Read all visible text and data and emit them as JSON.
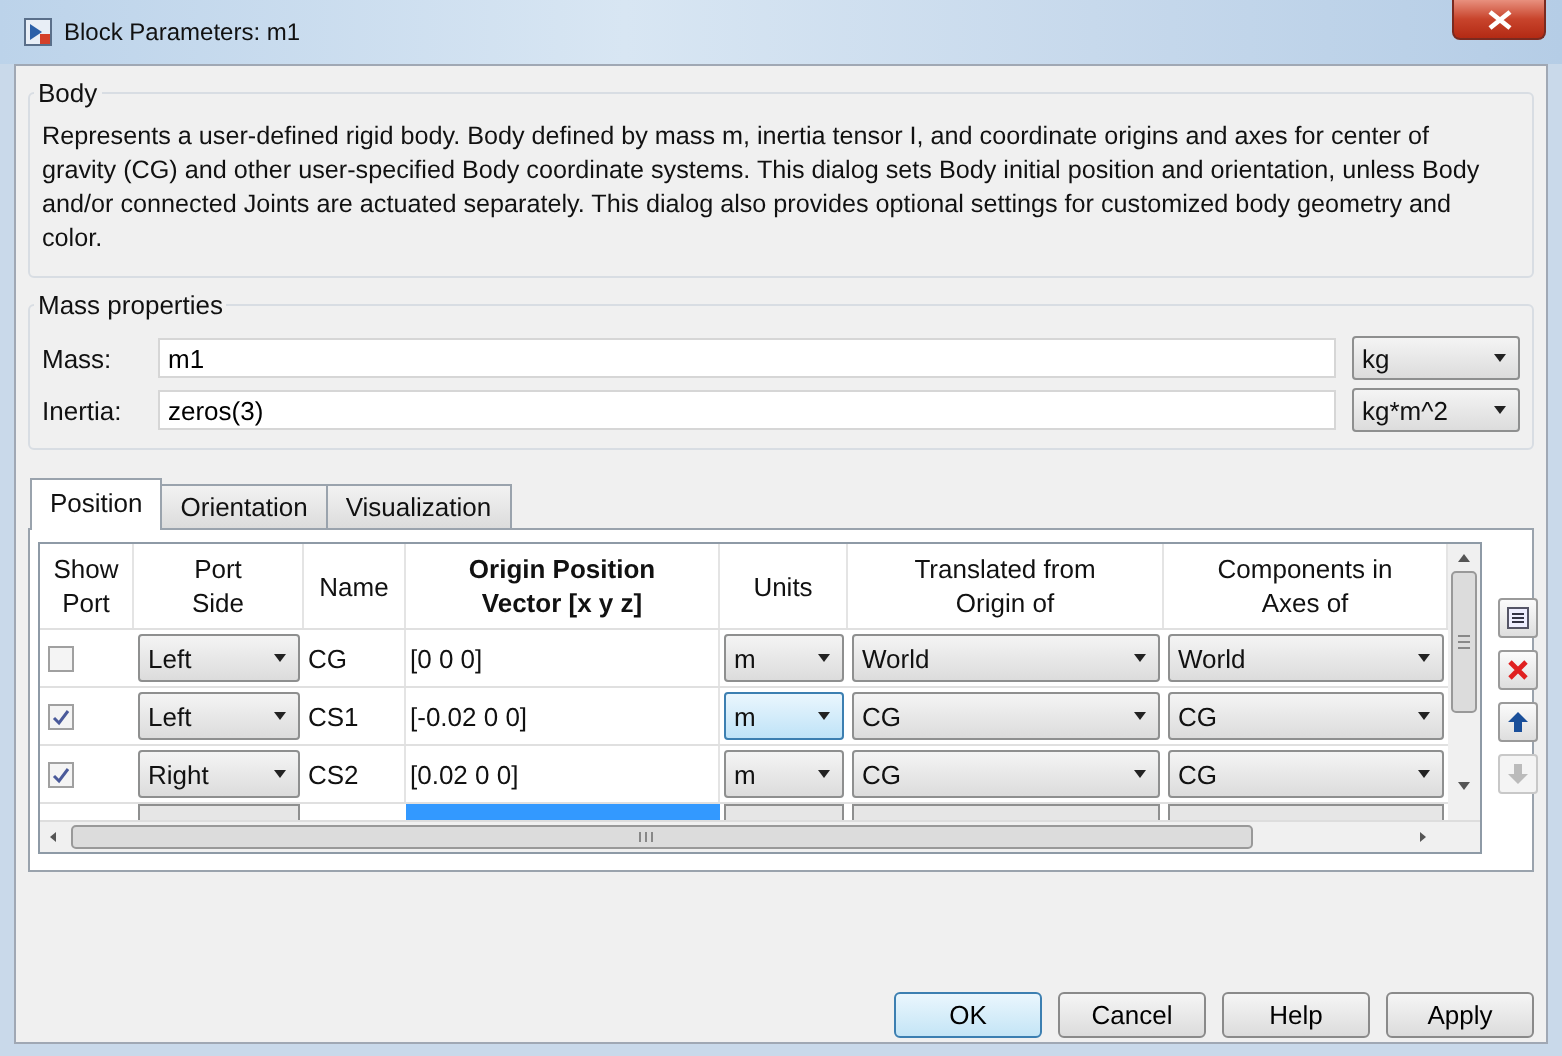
{
  "window": {
    "title": "Block Parameters: m1"
  },
  "body": {
    "legend": "Body",
    "description": "Represents a user-defined rigid body. Body defined by mass m, inertia tensor I, and coordinate origins and axes for center of gravity (CG) and other user-specified Body coordinate systems. This dialog sets Body initial position and orientation, unless Body and/or connected Joints are actuated separately. This dialog also provides optional settings for customized body geometry and color."
  },
  "mass_properties": {
    "legend": "Mass properties",
    "fields": [
      {
        "label": "Mass:",
        "value": "m1",
        "unit": "kg"
      },
      {
        "label": "Inertia:",
        "value": "zeros(3)",
        "unit": "kg*m^2"
      }
    ]
  },
  "tabs": [
    {
      "label": "Position",
      "selected": true
    },
    {
      "label": "Orientation",
      "selected": false
    },
    {
      "label": "Visualization",
      "selected": false
    }
  ],
  "table": {
    "columns": [
      {
        "label": "Show Port",
        "bold": false
      },
      {
        "label": "Port Side",
        "bold": false
      },
      {
        "label": "Name",
        "bold": false
      },
      {
        "label": "Origin Position Vector [x y z]",
        "bold": true
      },
      {
        "label": "Units",
        "bold": false
      },
      {
        "label": "Translated from Origin of",
        "bold": false
      },
      {
        "label": "Components in Axes of",
        "bold": false
      }
    ],
    "rows": [
      {
        "checked": false,
        "port_side": "Left",
        "name": "CG",
        "origin": "[0 0 0]",
        "units": "m",
        "units_focused": false,
        "translated_from": "World",
        "axes_of": "World"
      },
      {
        "checked": true,
        "port_side": "Left",
        "name": "CS1",
        "origin": "[-0.02 0 0]",
        "units": "m",
        "units_focused": true,
        "translated_from": "CG",
        "axes_of": "CG"
      },
      {
        "checked": true,
        "port_side": "Right",
        "name": "CS2",
        "origin": "[0.02 0 0]",
        "units": "m",
        "units_focused": false,
        "translated_from": "CG",
        "axes_of": "CG"
      }
    ]
  },
  "side_tools": [
    {
      "kind": "add",
      "disabled": false
    },
    {
      "kind": "delete",
      "disabled": false
    },
    {
      "kind": "up",
      "disabled": false
    },
    {
      "kind": "down",
      "disabled": true
    }
  ],
  "buttons": [
    {
      "label": "OK",
      "default": true
    },
    {
      "label": "Cancel",
      "default": false
    },
    {
      "label": "Help",
      "default": false
    },
    {
      "label": "Apply",
      "default": false
    }
  ]
}
